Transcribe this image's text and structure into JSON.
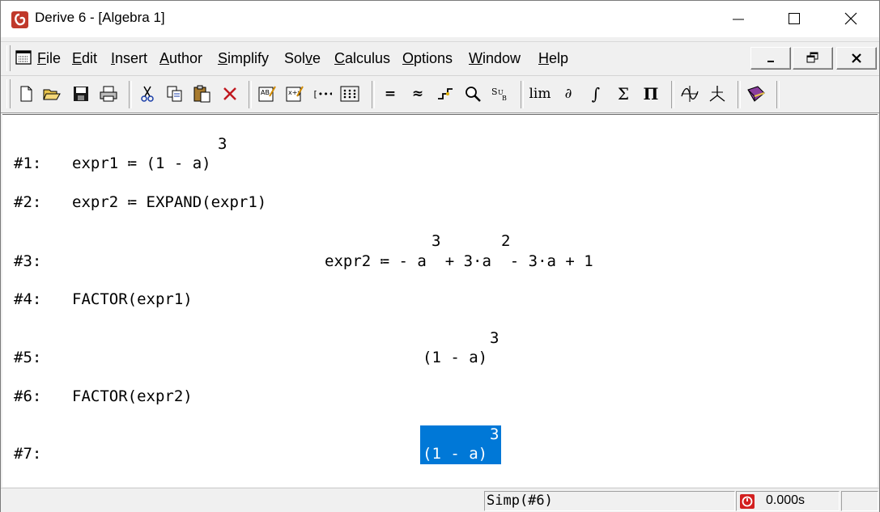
{
  "window": {
    "title": "Derive 6 - [Algebra 1]"
  },
  "menu": {
    "items": [
      {
        "pre": "",
        "u": "F",
        "post": "ile"
      },
      {
        "pre": "",
        "u": "E",
        "post": "dit"
      },
      {
        "pre": "",
        "u": "I",
        "post": "nsert"
      },
      {
        "pre": "",
        "u": "A",
        "post": "uthor"
      },
      {
        "pre": "",
        "u": "S",
        "post": "implify"
      },
      {
        "pre": "Sol",
        "u": "v",
        "post": "e"
      },
      {
        "pre": "",
        "u": "C",
        "post": "alculus"
      },
      {
        "pre": "",
        "u": "O",
        "post": "ptions"
      },
      {
        "pre": "",
        "u": "W",
        "post": "indow"
      },
      {
        "pre": "",
        "u": "H",
        "post": "elp"
      }
    ]
  },
  "toolbar": {
    "lim": "lim",
    "partial": "∂",
    "integral": "∫",
    "sum": "Σ",
    "product": "Π",
    "equals": "=",
    "approx": "≈"
  },
  "algebra": {
    "lines": [
      {
        "label": "#1:",
        "text": "expr1 ≔ (1 - a)",
        "sup": "3"
      },
      {
        "label": "#2:",
        "text": "expr2 ≔ EXPAND(expr1)"
      },
      {
        "label": "#3:",
        "text": "expr2 ≔ - a  + 3·a  - 3·a + 1",
        "sup1": "3",
        "sup2": "2"
      },
      {
        "label": "#4:",
        "text": "FACTOR(expr1)"
      },
      {
        "label": "#5:",
        "text": "(1 - a)",
        "sup": "3"
      },
      {
        "label": "#6:",
        "text": "FACTOR(expr2)"
      },
      {
        "label": "#7:",
        "text": "(1 - a)",
        "sup": "3",
        "selected": true
      }
    ]
  },
  "status": {
    "command": "Simp(#6)",
    "time": "0.000s"
  },
  "colors": {
    "selection": "#0078d7",
    "app_icon": "#c0392b",
    "timer": "#d32020"
  }
}
